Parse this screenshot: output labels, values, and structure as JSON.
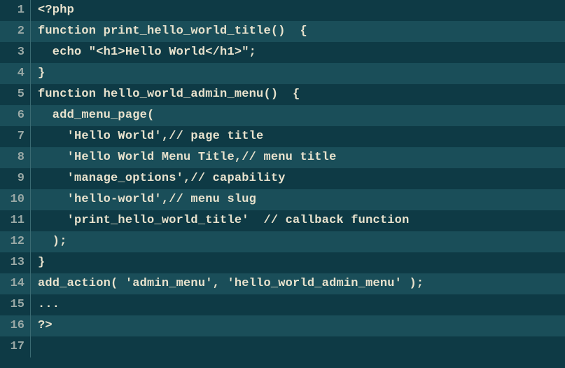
{
  "code_lines": [
    {
      "num": "1",
      "text": "<?php"
    },
    {
      "num": "2",
      "text": "function print_hello_world_title()  {"
    },
    {
      "num": "3",
      "text": "  echo \"<h1>Hello World</h1>\";"
    },
    {
      "num": "4",
      "text": "}"
    },
    {
      "num": "5",
      "text": "function hello_world_admin_menu()  {"
    },
    {
      "num": "6",
      "text": "  add_menu_page("
    },
    {
      "num": "7",
      "text": "    'Hello World',// page title"
    },
    {
      "num": "8",
      "text": "    'Hello World Menu Title,// menu title"
    },
    {
      "num": "9",
      "text": "    'manage_options',// capability"
    },
    {
      "num": "10",
      "text": "    'hello-world',// menu slug"
    },
    {
      "num": "11",
      "text": "    'print_hello_world_title'  // callback function"
    },
    {
      "num": "12",
      "text": "  );"
    },
    {
      "num": "13",
      "text": "}"
    },
    {
      "num": "14",
      "text": "add_action( 'admin_menu', 'hello_world_admin_menu' );"
    },
    {
      "num": "15",
      "text": "..."
    },
    {
      "num": "16",
      "text": "?>"
    },
    {
      "num": "17",
      "text": ""
    }
  ]
}
